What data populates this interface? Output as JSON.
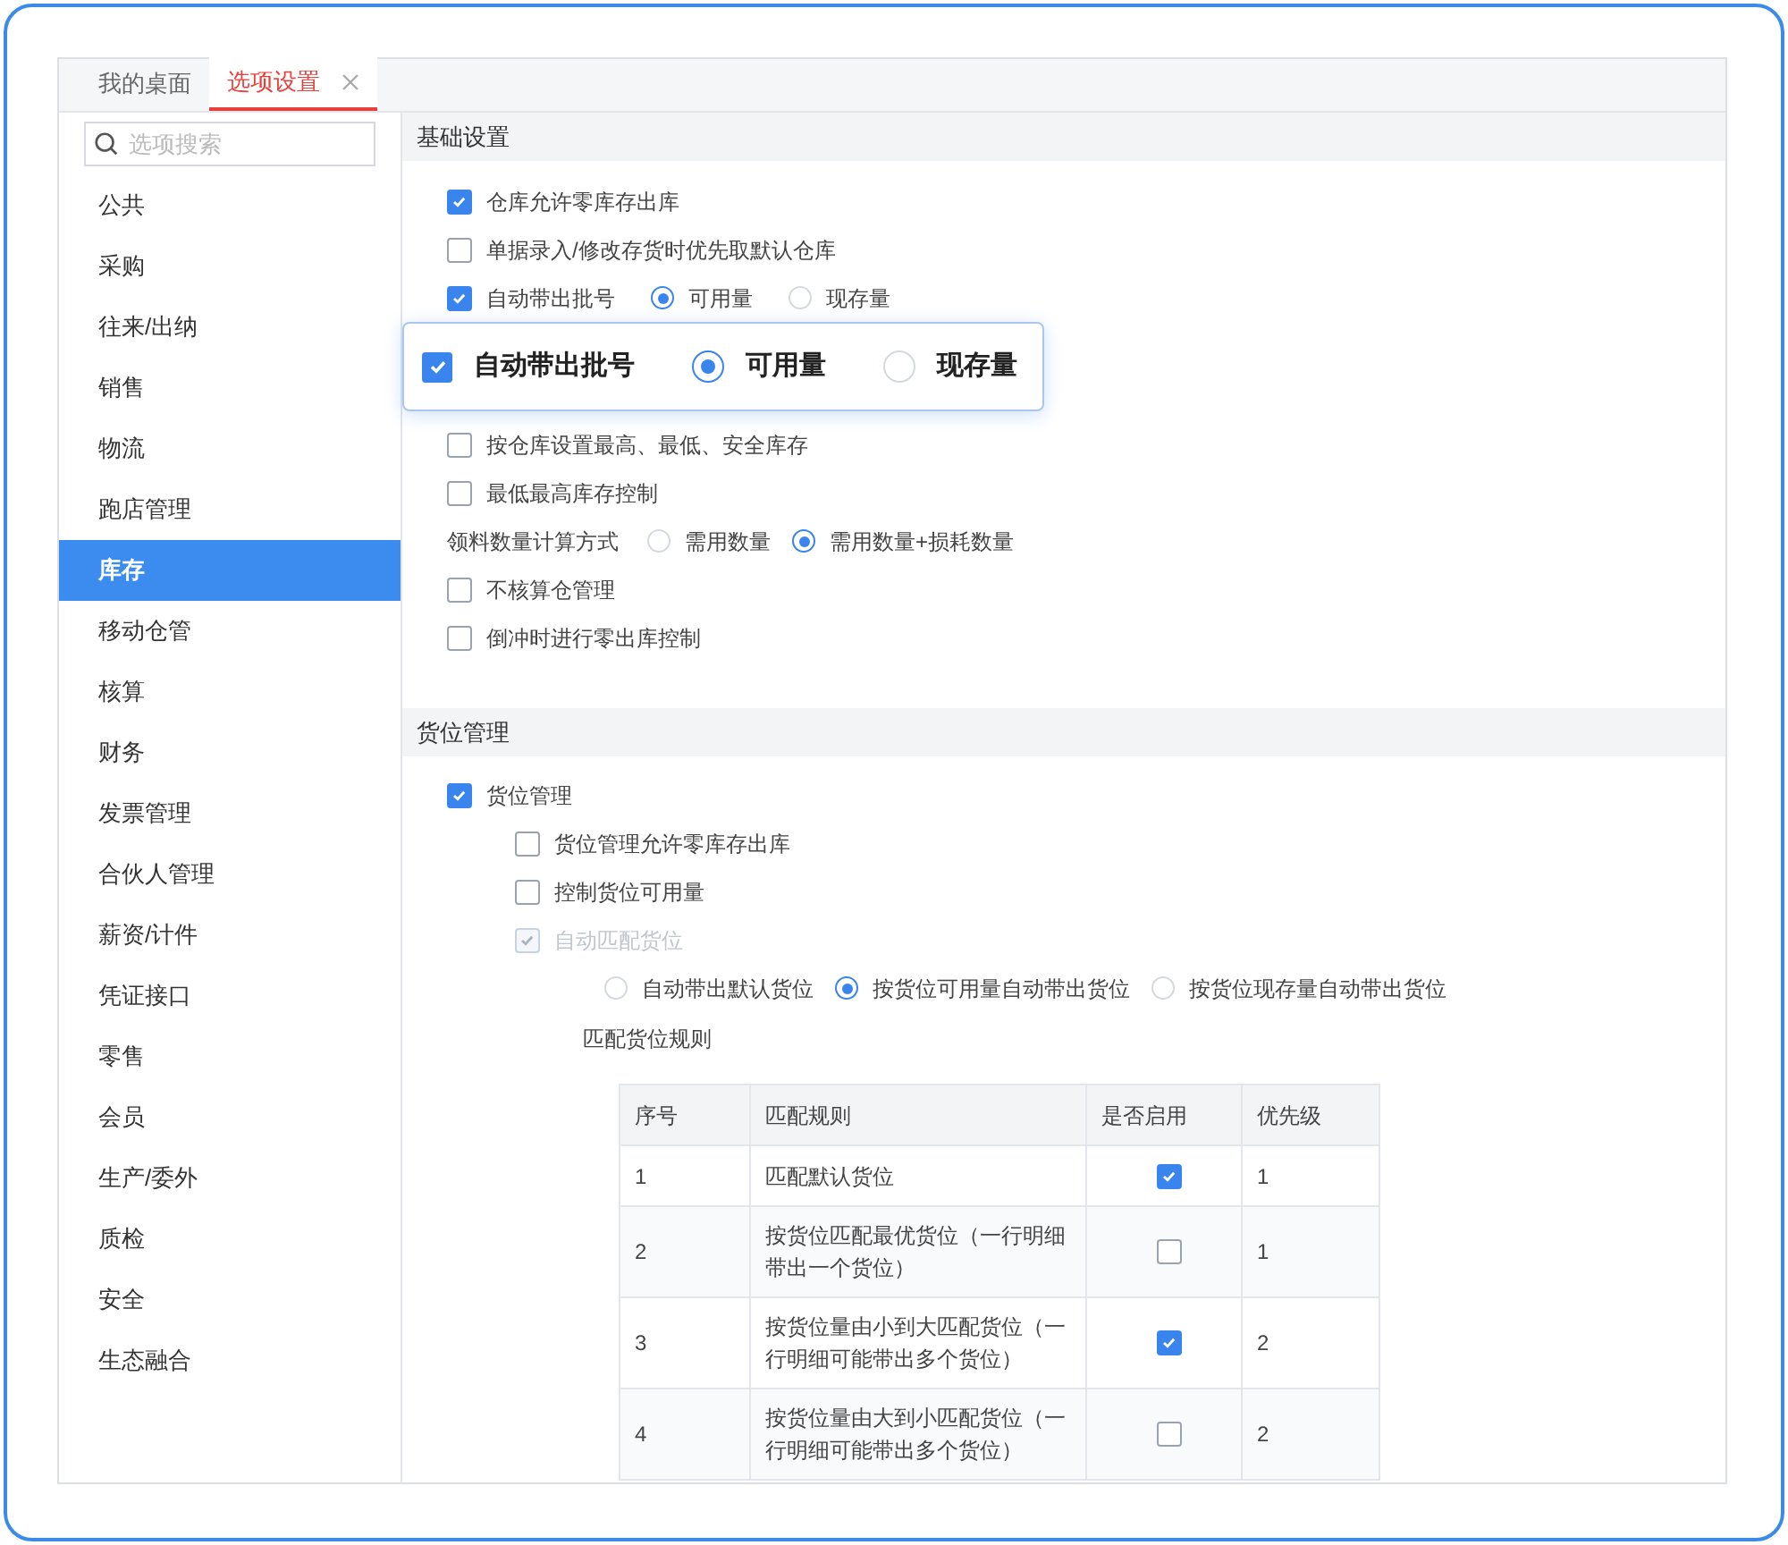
{
  "tabs": [
    {
      "label": "我的桌面",
      "selected": false,
      "closable": false
    },
    {
      "label": "选项设置",
      "selected": true,
      "closable": true
    }
  ],
  "search": {
    "placeholder": "选项搜索"
  },
  "sidebar": {
    "items": [
      {
        "label": "公共",
        "selected": false
      },
      {
        "label": "采购",
        "selected": false
      },
      {
        "label": "往来/出纳",
        "selected": false
      },
      {
        "label": "销售",
        "selected": false
      },
      {
        "label": "物流",
        "selected": false
      },
      {
        "label": "跑店管理",
        "selected": false
      },
      {
        "label": "库存",
        "selected": true
      },
      {
        "label": "移动仓管",
        "selected": false
      },
      {
        "label": "核算",
        "selected": false
      },
      {
        "label": "财务",
        "selected": false
      },
      {
        "label": "发票管理",
        "selected": false
      },
      {
        "label": "合伙人管理",
        "selected": false
      },
      {
        "label": "薪资/计件",
        "selected": false
      },
      {
        "label": "凭证接口",
        "selected": false
      },
      {
        "label": "零售",
        "selected": false
      },
      {
        "label": "会员",
        "selected": false
      },
      {
        "label": "生产/委外",
        "selected": false
      },
      {
        "label": "质检",
        "selected": false
      },
      {
        "label": "安全",
        "selected": false
      },
      {
        "label": "生态融合",
        "selected": false
      }
    ]
  },
  "sections": [
    {
      "title": "基础设置",
      "items": [
        {
          "kind": "checkbox",
          "label": "仓库允许零库存出库",
          "checked": true,
          "disabled": false
        },
        {
          "kind": "checkbox",
          "label": "单据录入/修改存货时优先取默认仓库",
          "checked": false,
          "disabled": false
        },
        {
          "kind": "checkbox",
          "label": "自动带出批号",
          "checked": true,
          "disabled": false,
          "options": [
            {
              "label": "可用量",
              "selected": true
            },
            {
              "label": "现存量",
              "selected": false
            }
          ]
        },
        {
          "kind": "callout",
          "label": "自动带出批号",
          "checked": true,
          "options": [
            {
              "label": "可用量",
              "selected": true
            },
            {
              "label": "现存量",
              "selected": false
            }
          ]
        },
        {
          "kind": "checkbox",
          "label": "按仓库设置最高、最低、安全库存",
          "checked": false,
          "disabled": false
        },
        {
          "kind": "checkbox",
          "label": "最低最高库存控制",
          "checked": false,
          "disabled": false
        },
        {
          "kind": "radio_group",
          "label": "领料数量计算方式",
          "options": [
            {
              "label": "需用数量",
              "selected": false
            },
            {
              "label": "需用数量+损耗数量",
              "selected": true
            }
          ]
        },
        {
          "kind": "checkbox",
          "label": "不核算仓管理",
          "checked": false,
          "disabled": false
        },
        {
          "kind": "checkbox",
          "label": "倒冲时进行零出库控制",
          "checked": false,
          "disabled": false
        }
      ]
    },
    {
      "title": "货位管理",
      "items": [
        {
          "kind": "checkbox",
          "label": "货位管理",
          "checked": true,
          "disabled": false,
          "children": [
            {
              "kind": "checkbox",
              "label": "货位管理允许零库存出库",
              "checked": false,
              "disabled": false
            },
            {
              "kind": "checkbox",
              "label": "控制货位可用量",
              "checked": false,
              "disabled": false
            },
            {
              "kind": "checkbox",
              "label": "自动匹配货位",
              "checked": true,
              "disabled": true,
              "children": [
                {
                  "kind": "radio_group",
                  "options": [
                    {
                      "label": "自动带出默认货位",
                      "selected": false
                    },
                    {
                      "label": "按货位可用量自动带出货位",
                      "selected": true
                    },
                    {
                      "label": "按货位现存量自动带出货位",
                      "selected": false
                    }
                  ]
                },
                {
                  "kind": "text",
                  "label": "匹配货位规则"
                },
                {
                  "kind": "table",
                  "columns": [
                    "序号",
                    "匹配规则",
                    "是否启用",
                    "优先级"
                  ],
                  "rows": [
                    {
                      "no": "1",
                      "rule": "匹配默认货位",
                      "enabled": true,
                      "priority": "1"
                    },
                    {
                      "no": "2",
                      "rule": "按货位匹配最优货位（一行明细带出一个货位）",
                      "enabled": false,
                      "priority": "1"
                    },
                    {
                      "no": "3",
                      "rule": "按货位量由小到大匹配货位（一行明细可能带出多个货位）",
                      "enabled": true,
                      "priority": "2"
                    },
                    {
                      "no": "4",
                      "rule": "按货位量由大到小匹配货位（一行明细可能带出多个货位）",
                      "enabled": false,
                      "priority": "2"
                    }
                  ]
                }
              ]
            }
          ]
        }
      ]
    }
  ]
}
